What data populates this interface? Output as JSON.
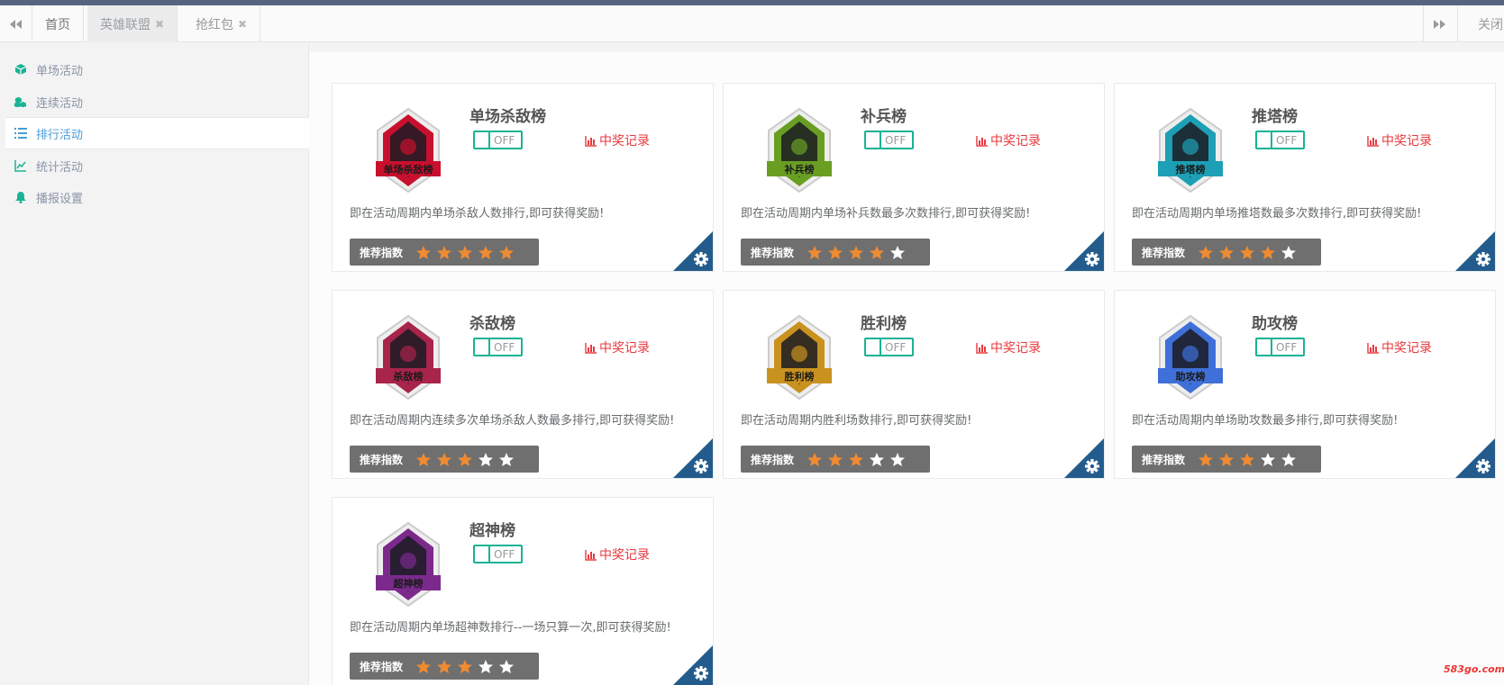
{
  "tabs": {
    "home": "首页",
    "items": [
      {
        "label": "英雄联盟",
        "close": "✖"
      },
      {
        "label": "抢红包",
        "close": "✖"
      }
    ],
    "close_all": "关闭"
  },
  "sidebar": {
    "items": [
      {
        "label": "单场活动",
        "icon": "cube-icon"
      },
      {
        "label": "连续活动",
        "icon": "cubes-icon"
      },
      {
        "label": "排行活动",
        "icon": "list-icon"
      },
      {
        "label": "统计活动",
        "icon": "line-chart-icon"
      },
      {
        "label": "播报设置",
        "icon": "bell-icon"
      }
    ]
  },
  "common": {
    "toggle_label": "OFF",
    "award_label": "中奖记录",
    "rec_label": "推荐指数"
  },
  "colors": {
    "accent_green": "#1ab394",
    "award_red": "#e8383d",
    "star_on": "#f08b32",
    "star_off": "#ffffff",
    "corner_blue": "#235c8c"
  },
  "cards": [
    {
      "title": "单场杀敌榜",
      "badge_text": "单场杀敌榜",
      "badge_color": "#c8102e",
      "desc": "即在活动周期内单场杀敌人数排行,即可获得奖励!",
      "rating": 5
    },
    {
      "title": "补兵榜",
      "badge_text": "补兵榜",
      "badge_color": "#6a9e23",
      "desc": "即在活动周期内单场补兵数最多次数排行,即可获得奖励!",
      "rating": 4
    },
    {
      "title": "推塔榜",
      "badge_text": "推塔榜",
      "badge_color": "#1d9fb5",
      "desc": "即在活动周期内单场推塔数最多次数排行,即可获得奖励!",
      "rating": 4
    },
    {
      "title": "杀敌榜",
      "badge_text": "杀敌榜",
      "badge_color": "#a8244a",
      "desc": "即在活动周期内连续多次单场杀敌人数最多排行,即可获得奖励!",
      "rating": 3
    },
    {
      "title": "胜利榜",
      "badge_text": "胜利榜",
      "badge_color": "#c9921e",
      "desc": "即在活动周期内胜利场数排行,即可获得奖励!",
      "rating": 3
    },
    {
      "title": "助攻榜",
      "badge_text": "助攻榜",
      "badge_color": "#3f6fd8",
      "desc": "即在活动周期内单场助攻数最多排行,即可获得奖励!",
      "rating": 3
    },
    {
      "title": "超神榜",
      "badge_text": "超神榜",
      "badge_color": "#7b2a8c",
      "desc": "即在活动周期内单场超神数排行--一场只算一次,即可获得奖励!",
      "rating": 3
    }
  ],
  "watermark": "583go.com"
}
